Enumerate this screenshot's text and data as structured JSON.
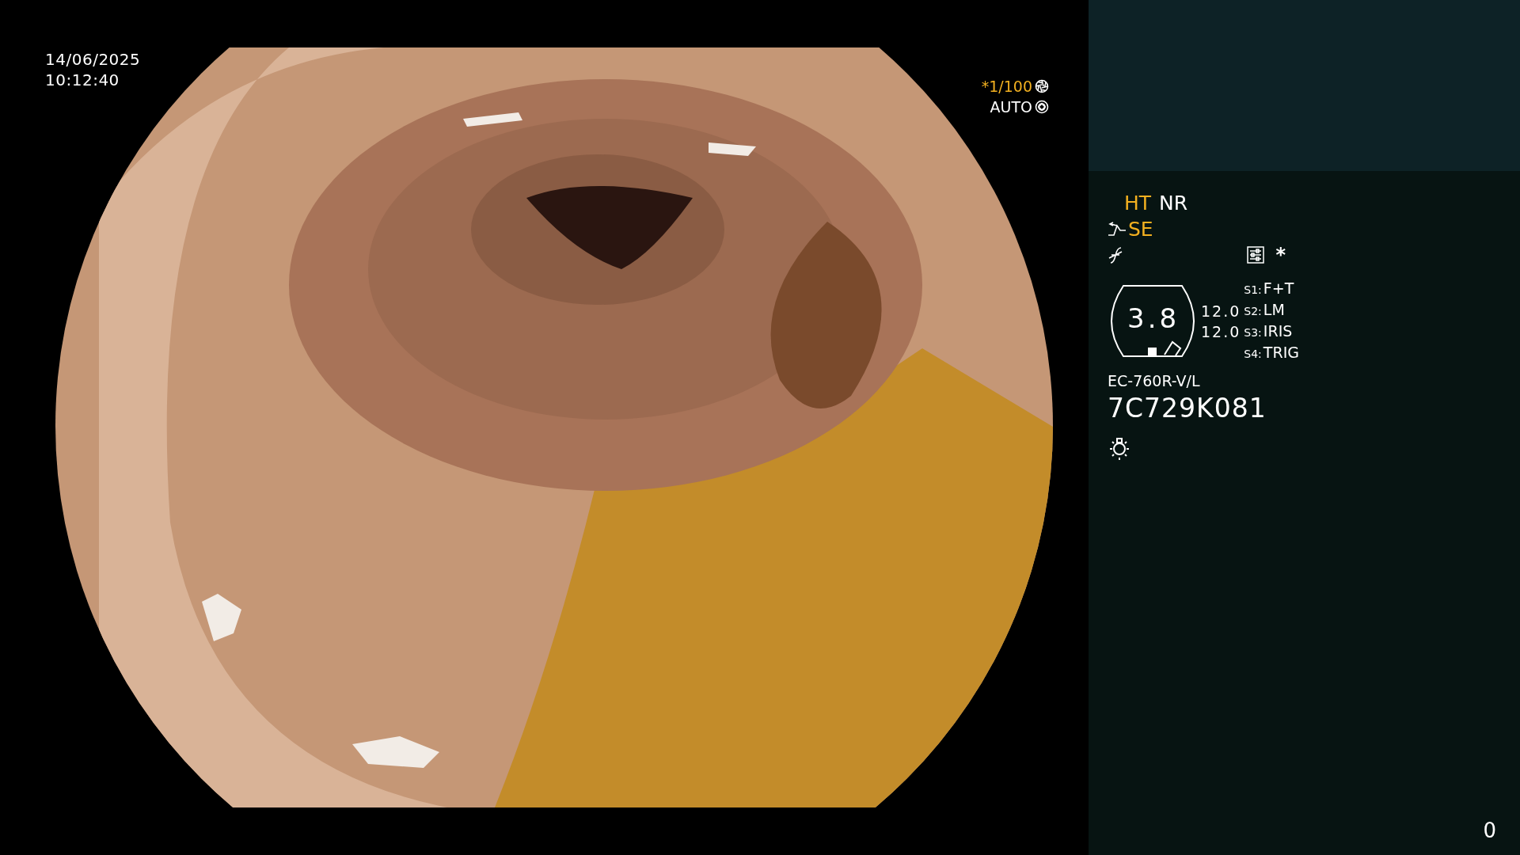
{
  "date": "14/06/2025",
  "time": "10:12:40",
  "shutter": {
    "text": "*1/100",
    "active": true
  },
  "iris_mode": {
    "text": "AUTO",
    "active": false
  },
  "modes": [
    {
      "label": "HT",
      "active": true
    },
    {
      "label": "NR",
      "active": false
    }
  ],
  "enhance": {
    "label": "SE",
    "active": true
  },
  "extra_mark": "*",
  "gauge_reading": "3.8",
  "values": [
    "12.0",
    "12.0"
  ],
  "switches": [
    {
      "key": "S1:",
      "function": "F+T"
    },
    {
      "key": "S2:",
      "function": "LM"
    },
    {
      "key": "S3:",
      "function": "IRIS"
    },
    {
      "key": "S4:",
      "function": "TRIG"
    }
  ],
  "scope_model": "EC-760R-V/L",
  "serial": "7C729K081",
  "counter": "0"
}
